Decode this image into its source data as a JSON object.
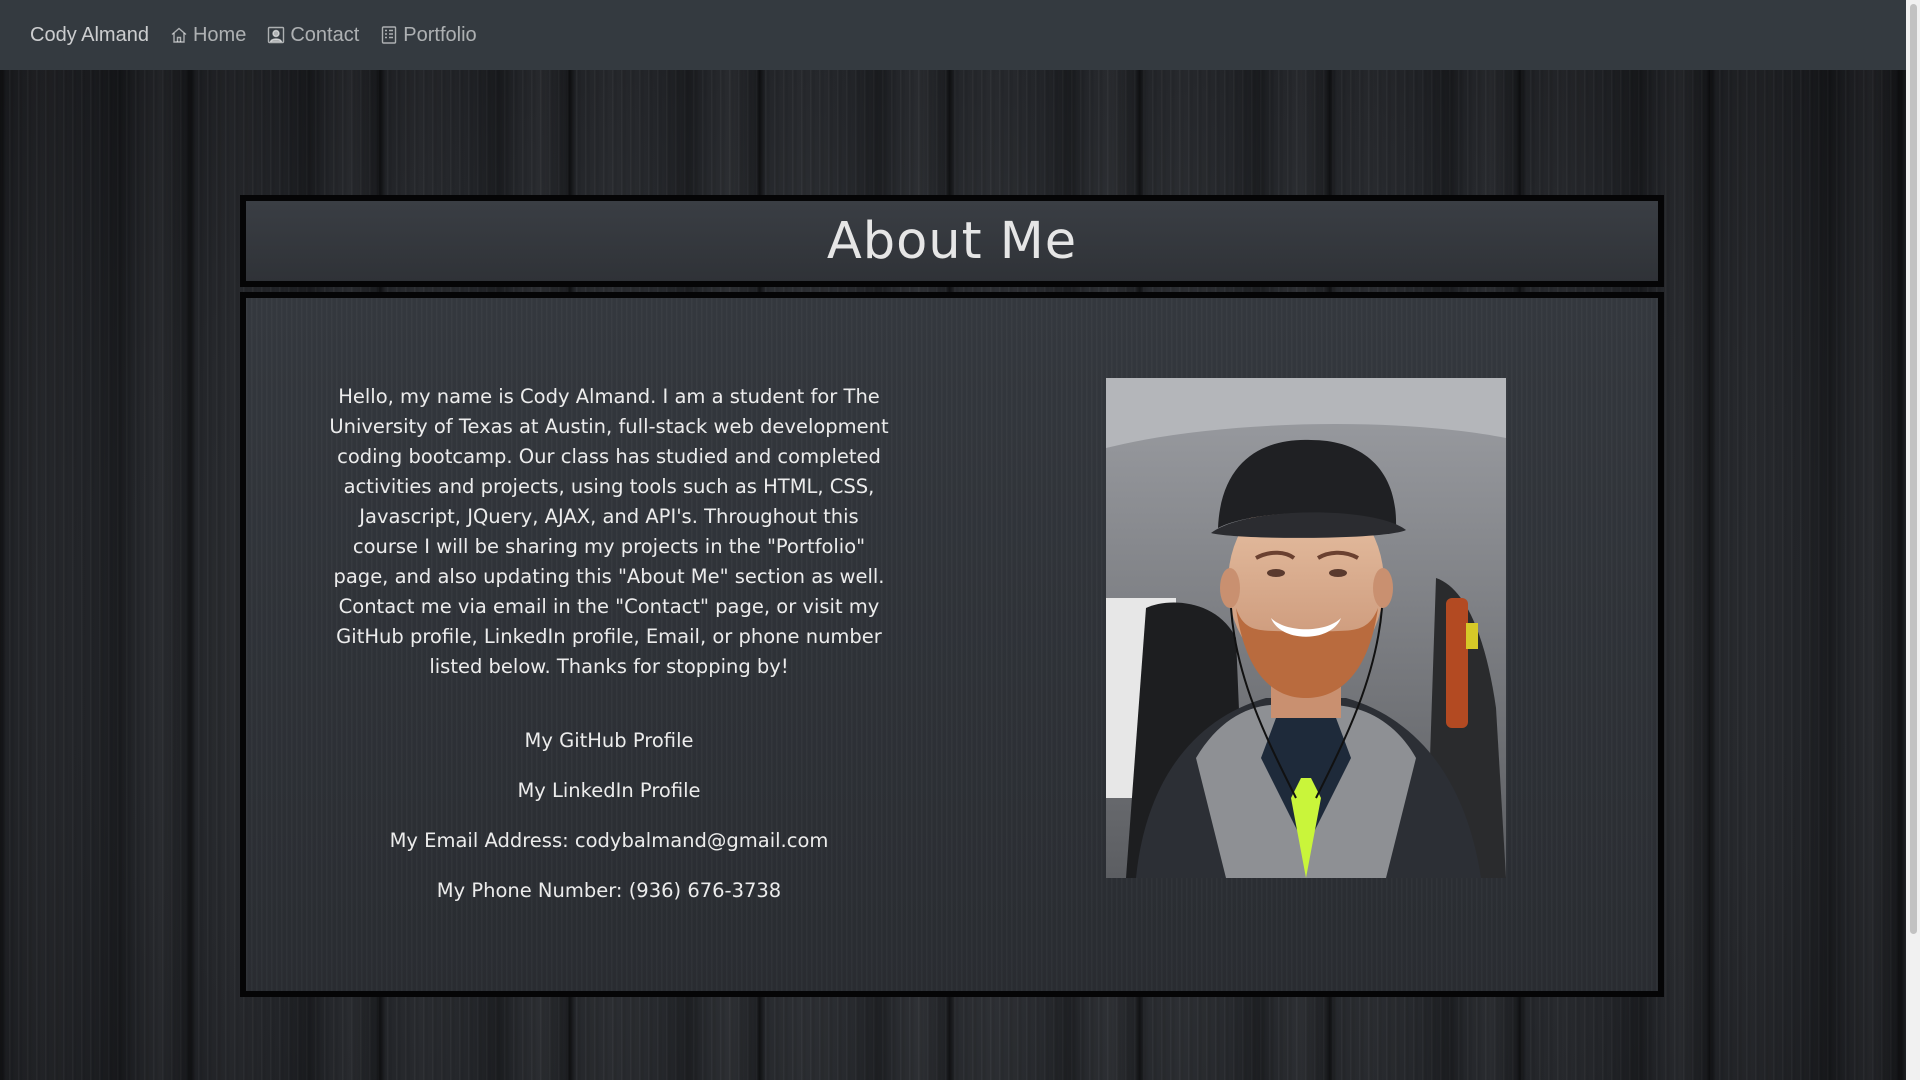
{
  "nav": {
    "brand": "Cody Almand",
    "items": [
      {
        "label": "Home",
        "icon": "home-icon"
      },
      {
        "label": "Contact",
        "icon": "contact-icon"
      },
      {
        "label": "Portfolio",
        "icon": "portfolio-icon"
      }
    ]
  },
  "page": {
    "title": "About Me"
  },
  "about": {
    "bio": "Hello, my name is Cody Almand. I am a student for The University of Texas at Austin, full-stack web development coding bootcamp. Our class has studied and completed activities and projects, using tools such as HTML, CSS, Javascript, JQuery, AJAX, and API's. Throughout this course I will be sharing my projects in the \"Portfolio\" page, and also updating this \"About Me\" section as well. Contact me via email in the \"Contact\" page, or visit my GitHub profile, LinkedIn profile, Email, or phone number listed below. Thanks for stopping by!",
    "github_link": "My GitHub Profile",
    "linkedin_link": "My LinkedIn Profile",
    "email": "My Email Address: codybalmand@gmail.com",
    "phone": "My Phone Number: (936) 676-3738",
    "photo": "profile-photo"
  },
  "colors": {
    "navbar": "#343a40",
    "panel_border": "#050506",
    "text": "#ececec"
  }
}
